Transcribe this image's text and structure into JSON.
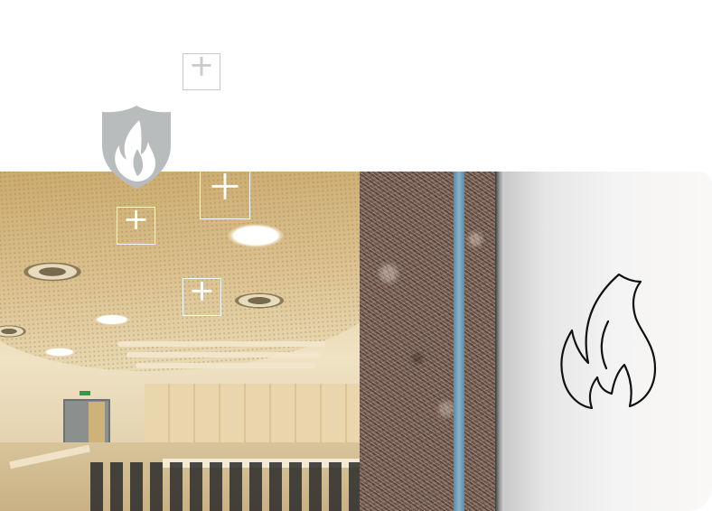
{
  "scene": {
    "panels": [
      "auditorium-photo",
      "wool-insulation",
      "fire-resistant-board"
    ],
    "colors": {
      "shield": "#b9bcbc",
      "flame_fill": "#ffffff",
      "plus_dark": "#c9c9c9",
      "plus_light": "#ffffff",
      "membrane": "#6f9fba",
      "flame_outline": "#111111"
    }
  },
  "icons": {
    "shield": "shield-flame-icon",
    "outline_flame": "flame-outline-icon",
    "plus": "plus-icon"
  },
  "hotspots": [
    {
      "name": "hotspot-top",
      "style": "light"
    },
    {
      "name": "hotspot-ceiling",
      "style": "white"
    },
    {
      "name": "hotspot-left",
      "style": "white"
    },
    {
      "name": "hotspot-middle",
      "style": "white"
    }
  ]
}
